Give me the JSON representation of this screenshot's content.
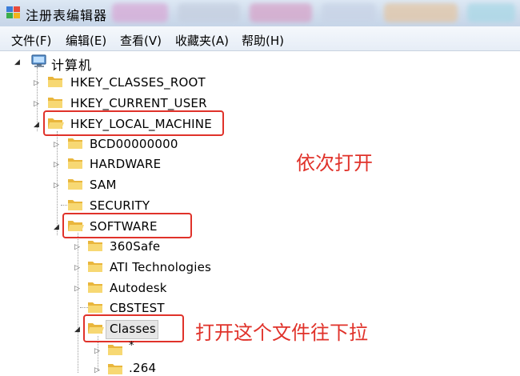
{
  "window": {
    "title": "注册表编辑器"
  },
  "menu": [
    {
      "label": "文件(F)"
    },
    {
      "label": "编辑(E)"
    },
    {
      "label": "查看(V)"
    },
    {
      "label": "收藏夹(A)"
    },
    {
      "label": "帮助(H)"
    }
  ],
  "tree": {
    "root": "计算机",
    "hkey_classes_root": "HKEY_CLASSES_ROOT",
    "hkey_current_user": "HKEY_CURRENT_USER",
    "hkey_local_machine": "HKEY_LOCAL_MACHINE",
    "hklm_children": [
      "BCD00000000",
      "HARDWARE",
      "SAM",
      "SECURITY",
      "SOFTWARE"
    ],
    "software_children": [
      "360Safe",
      "ATI Technologies",
      "Autodesk",
      "CBSTEST",
      "Classes"
    ],
    "classes_children": [
      "*",
      ".264"
    ]
  },
  "annotations": {
    "open_in_order": "依次打开",
    "open_and_scroll": "打开这个文件往下拉"
  },
  "colors": {
    "highlight": "#e0322a",
    "folder": "#f3c44b"
  }
}
